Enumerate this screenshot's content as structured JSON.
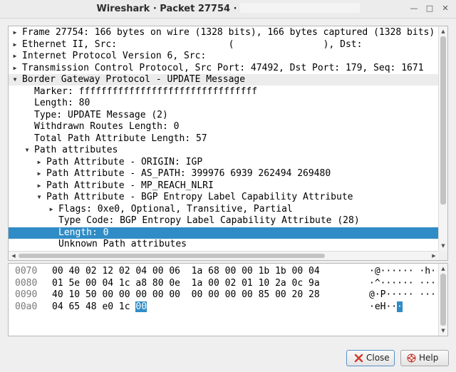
{
  "window": {
    "title": "Wireshark · Packet 27754 ·",
    "controls": [
      "minimize-icon",
      "maximize-icon",
      "close-icon"
    ]
  },
  "tree": {
    "rows": [
      {
        "text": "Frame 27754: 166 bytes on wire (1328 bits), 166 bytes captured (1328 bits)",
        "indent": 0,
        "arrow": "collapsed",
        "selected": false
      },
      {
        "text": "Ethernet II, Src:                    (                ), Dst:",
        "indent": 0,
        "arrow": "collapsed",
        "selected": false
      },
      {
        "text": "Internet Protocol Version 6, Src:",
        "indent": 0,
        "arrow": "collapsed",
        "selected": false
      },
      {
        "text": "Transmission Control Protocol, Src Port: 47492, Dst Port: 179, Seq: 1671",
        "indent": 0,
        "arrow": "collapsed",
        "selected": false
      },
      {
        "text": "Border Gateway Protocol - UPDATE Message",
        "indent": 0,
        "arrow": "expanded",
        "selected": false
      },
      {
        "text": "Marker: ffffffffffffffffffffffffffffffff",
        "indent": 1,
        "arrow": "none",
        "selected": false
      },
      {
        "text": "Length: 80",
        "indent": 1,
        "arrow": "none",
        "selected": false
      },
      {
        "text": "Type: UPDATE Message (2)",
        "indent": 1,
        "arrow": "none",
        "selected": false
      },
      {
        "text": "Withdrawn Routes Length: 0",
        "indent": 1,
        "arrow": "none",
        "selected": false
      },
      {
        "text": "Total Path Attribute Length: 57",
        "indent": 1,
        "arrow": "none",
        "selected": false
      },
      {
        "text": "Path attributes",
        "indent": 1,
        "arrow": "expanded",
        "selected": false
      },
      {
        "text": "Path Attribute - ORIGIN: IGP",
        "indent": 2,
        "arrow": "collapsed",
        "selected": false
      },
      {
        "text": "Path Attribute - AS_PATH: 399976 6939 262494 269480",
        "indent": 2,
        "arrow": "collapsed",
        "selected": false
      },
      {
        "text": "Path Attribute - MP_REACH_NLRI",
        "indent": 2,
        "arrow": "collapsed",
        "selected": false
      },
      {
        "text": "Path Attribute - BGP Entropy Label Capability Attribute",
        "indent": 2,
        "arrow": "expanded",
        "selected": false
      },
      {
        "text": "Flags: 0xe0, Optional, Transitive, Partial",
        "indent": 3,
        "arrow": "collapsed",
        "selected": false
      },
      {
        "text": "Type Code: BGP Entropy Label Capability Attribute (28)",
        "indent": 3,
        "arrow": "none",
        "selected": false
      },
      {
        "text": "Length: 0",
        "indent": 3,
        "arrow": "none",
        "selected": true
      },
      {
        "text": "Unknown Path attributes",
        "indent": 3,
        "arrow": "none",
        "selected": false
      }
    ]
  },
  "hex": {
    "lines": [
      {
        "offset": "0070",
        "bytes": "00 40 02 12 02 04 00 06  1a 68 00 00 1b 1b 00 04",
        "ascii": "·@······ ·h······",
        "hl_bytes": "",
        "hl_ascii": ""
      },
      {
        "offset": "0080",
        "bytes": "01 5e 00 04 1c a8 80 0e  1a 00 02 01 10 2a 0c 9a",
        "ascii": "·^······ ·····*··",
        "hl_bytes": "",
        "hl_ascii": ""
      },
      {
        "offset": "0090",
        "bytes": "40 10 50 00 00 00 00 00  00 00 00 00 85 00 20 28",
        "ascii": "@·P····· ······ (",
        "hl_bytes": "",
        "hl_ascii": ""
      },
      {
        "offset": "00a0",
        "bytes": "04 65 48 e0 1c ",
        "ascii": "·eH··",
        "hl_bytes": "00",
        "hl_ascii": "·"
      }
    ]
  },
  "buttons": {
    "close_label": "Close",
    "help_label": "Help"
  },
  "colors": {
    "selection": "#308cc6",
    "close_icon_red": "#d03a2b",
    "help_icon_red": "#c0392b"
  }
}
